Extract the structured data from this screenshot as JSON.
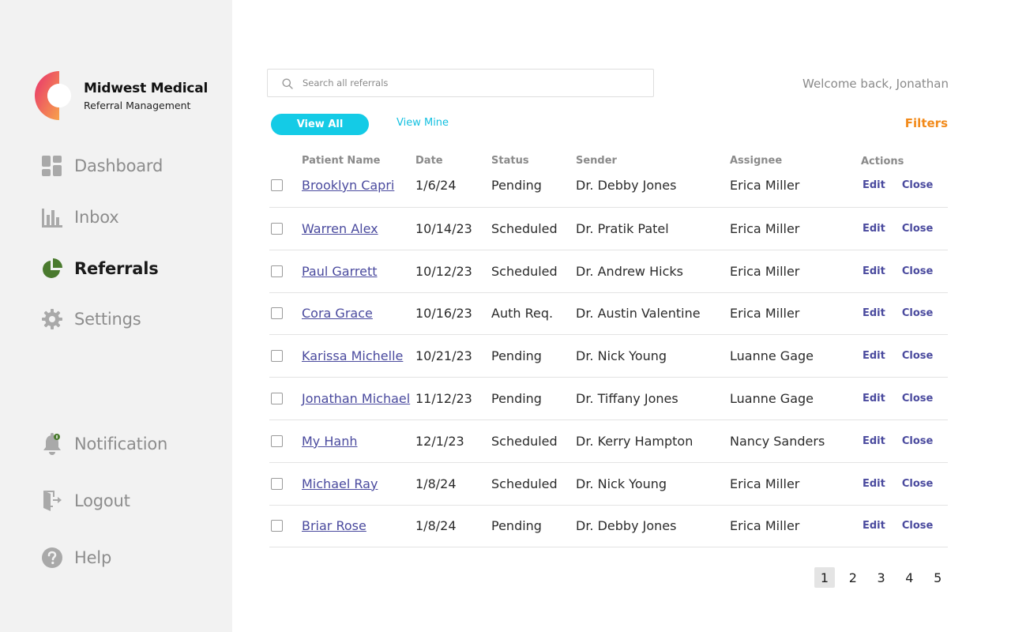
{
  "brand": {
    "name": "Midwest Medical",
    "subtitle": "Referral Management",
    "logo_colors": [
      "#e8316e",
      "#f7a24b"
    ]
  },
  "sidebar": {
    "top_items": [
      {
        "label": "Dashboard",
        "icon": "dashboard-icon",
        "active": false
      },
      {
        "label": "Inbox",
        "icon": "bar-chart-icon",
        "active": false
      },
      {
        "label": "Referrals",
        "icon": "pie-chart-icon",
        "active": true
      },
      {
        "label": "Settings",
        "icon": "gear-icon",
        "active": false
      }
    ],
    "bottom_items": [
      {
        "label": "Notification",
        "icon": "bell-icon"
      },
      {
        "label": "Logout",
        "icon": "logout-icon"
      },
      {
        "label": "Help",
        "icon": "help-icon"
      }
    ],
    "active_color": "#4a7a2e"
  },
  "search": {
    "placeholder": "Search all referrals",
    "value": ""
  },
  "welcome": "Welcome back, Jonathan",
  "toolbar": {
    "view_all": "View All",
    "view_mine": "View Mine",
    "filters": "Filters"
  },
  "table": {
    "headers": {
      "patient": "Patient Name",
      "date": "Date",
      "status": "Status",
      "sender": "Sender",
      "assignee": "Assignee",
      "actions": "Actions"
    },
    "edit_label": "Edit",
    "close_label": "Close",
    "rows": [
      {
        "patient": "Brooklyn Capri",
        "date": "1/6/24",
        "status": "Pending",
        "sender": "Dr. Debby Jones",
        "assignee": "Erica Miller"
      },
      {
        "patient": "Warren Alex",
        "date": "10/14/23",
        "status": "Scheduled",
        "sender": "Dr. Pratik Patel",
        "assignee": "Erica Miller"
      },
      {
        "patient": "Paul Garrett",
        "date": "10/12/23",
        "status": "Scheduled",
        "sender": "Dr. Andrew Hicks",
        "assignee": "Erica Miller"
      },
      {
        "patient": "Cora Grace",
        "date": "10/16/23",
        "status": "Auth Req.",
        "sender": "Dr. Austin Valentine",
        "assignee": "Erica Miller"
      },
      {
        "patient": "Karissa Michelle",
        "date": "10/21/23",
        "status": "Pending",
        "sender": "Dr. Nick Young",
        "assignee": "Luanne Gage"
      },
      {
        "patient": "Jonathan Michael",
        "date": "11/12/23",
        "status": "Pending",
        "sender": "Dr. Tiffany Jones",
        "assignee": "Luanne Gage"
      },
      {
        "patient": "My Hanh",
        "date": "12/1/23",
        "status": "Scheduled",
        "sender": "Dr. Kerry Hampton",
        "assignee": "Nancy Sanders"
      },
      {
        "patient": "Michael Ray",
        "date": "1/8/24",
        "status": "Scheduled",
        "sender": "Dr. Nick Young",
        "assignee": "Erica Miller"
      },
      {
        "patient": "Briar Rose",
        "date": "1/8/24",
        "status": "Pending",
        "sender": "Dr. Debby Jones",
        "assignee": "Erica Miller"
      }
    ]
  },
  "pagination": {
    "pages": [
      "1",
      "2",
      "3",
      "4",
      "5"
    ],
    "current": "1"
  }
}
